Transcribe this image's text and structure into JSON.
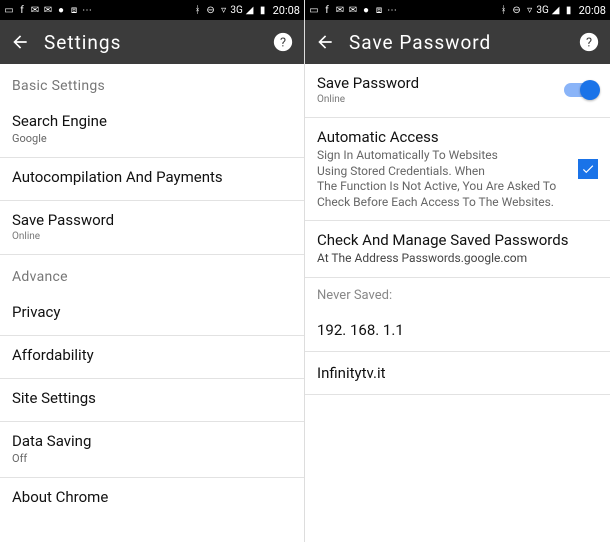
{
  "statusbar": {
    "clock": "20:08",
    "net_label": "3G"
  },
  "left": {
    "title": "Settings",
    "basic_header": "Basic Settings",
    "items": {
      "search": {
        "label": "Search Engine",
        "value": "Google"
      },
      "autocomp": {
        "label": "Autocompilation And Payments"
      },
      "savepw": {
        "label": "Save Password",
        "value": "Online"
      },
      "advance_header": "Advance",
      "privacy": {
        "label": "Privacy"
      },
      "affordability": {
        "label": "Affordability"
      },
      "sitesettings": {
        "label": "Site Settings"
      },
      "datasaving": {
        "label": "Data Saving",
        "value": "Off"
      },
      "about": {
        "label": "About Chrome"
      }
    }
  },
  "right": {
    "title": "Save Password",
    "toggle": {
      "label": "Save Password",
      "sub": "Online",
      "on": true
    },
    "auto": {
      "heading": "Automatic Access",
      "line1": "Sign In Automatically To Websites",
      "line2": "Using Stored Credentials. When",
      "line3": "The Function Is Not Active, You Are Asked To Check Before Each Access To The Websites.",
      "checked": true
    },
    "manage": {
      "heading": "Check And Manage Saved Passwords",
      "sub": "At The Address Passwords.google.com"
    },
    "never_saved_label": "Never Saved:",
    "entries": [
      "192. 168. 1.1",
      "Infinitytv.it"
    ]
  }
}
